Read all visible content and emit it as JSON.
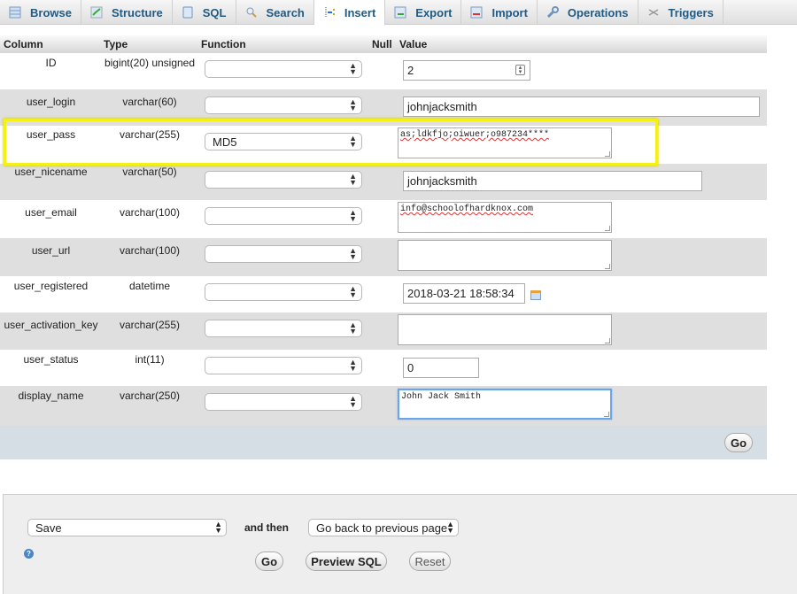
{
  "tabs": [
    {
      "label": "Browse",
      "icon": "browse-icon",
      "active": false
    },
    {
      "label": "Structure",
      "icon": "structure-icon",
      "active": false
    },
    {
      "label": "SQL",
      "icon": "sql-icon",
      "active": false
    },
    {
      "label": "Search",
      "icon": "search-icon",
      "active": false
    },
    {
      "label": "Insert",
      "icon": "insert-icon",
      "active": true
    },
    {
      "label": "Export",
      "icon": "export-icon",
      "active": false
    },
    {
      "label": "Import",
      "icon": "import-icon",
      "active": false
    },
    {
      "label": "Operations",
      "icon": "operations-icon",
      "active": false
    },
    {
      "label": "Triggers",
      "icon": "triggers-icon",
      "active": false
    }
  ],
  "table_header": {
    "column": "Column",
    "type": "Type",
    "function": "Function",
    "null": "Null",
    "value": "Value"
  },
  "rows": [
    {
      "column": "ID",
      "type": "bigint(20) unsigned",
      "function": "",
      "value": "2"
    },
    {
      "column": "user_login",
      "type": "varchar(60)",
      "function": "",
      "value": "johnjacksmith"
    },
    {
      "column": "user_pass",
      "type": "varchar(255)",
      "function": "MD5",
      "value": "as;ldkfjo;oiwuer;o987234****"
    },
    {
      "column": "user_nicename",
      "type": "varchar(50)",
      "function": "",
      "value": "johnjacksmith"
    },
    {
      "column": "user_email",
      "type": "varchar(100)",
      "function": "",
      "value": "info@schoolofhardknox.com"
    },
    {
      "column": "user_url",
      "type": "varchar(100)",
      "function": "",
      "value": ""
    },
    {
      "column": "user_registered",
      "type": "datetime",
      "function": "",
      "value": "2018-03-21 18:58:34"
    },
    {
      "column": "user_activation_key",
      "type": "varchar(255)",
      "function": "",
      "value": ""
    },
    {
      "column": "user_status",
      "type": "int(11)",
      "function": "",
      "value": "0"
    },
    {
      "column": "display_name",
      "type": "varchar(250)",
      "function": "",
      "value": "John Jack Smith"
    }
  ],
  "go_label": "Go",
  "bottom": {
    "action_select": "Save",
    "and_then": "and then",
    "after_select": "Go back to previous page",
    "go_label": "Go",
    "preview_label": "Preview SQL",
    "reset_label": "Reset"
  },
  "colors": {
    "link": "#235a81",
    "highlight": "#f5f016",
    "focus": "#6ba4e8"
  }
}
